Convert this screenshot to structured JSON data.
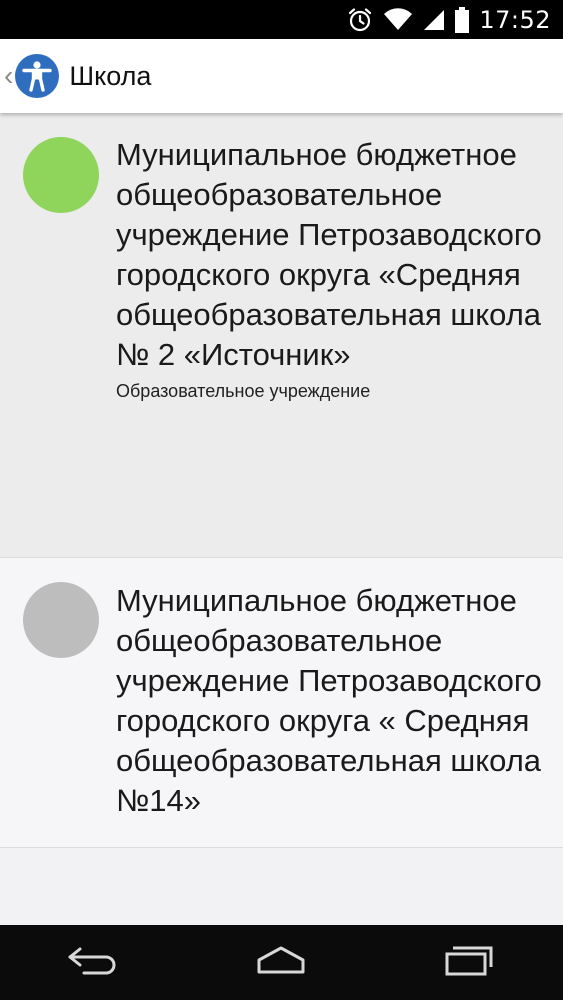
{
  "status_bar": {
    "time": "17:52",
    "icons": [
      "alarm-icon",
      "wifi-icon",
      "signal-icon",
      "battery-icon"
    ]
  },
  "action_bar": {
    "back_icon": "chevron-left-icon",
    "app_icon": "accessibility-icon",
    "title": "Школа",
    "app_icon_color": "#2f6ebf"
  },
  "list": {
    "items": [
      {
        "title": "Муниципальное бюджетное общеобразовательное учреждение Петрозаводского городского округа «Средняя общеобразовательная школа № 2 «Источник»",
        "subtitle": "Образовательное учреждение",
        "status_color": "#8fd45b"
      },
      {
        "title": "Муниципальное бюджетное общеобразовательное учреждение Петрозаводского городского округа « Средняя общеобразовательная школа №14»",
        "subtitle": "",
        "status_color": "#bdbdbd"
      }
    ]
  },
  "nav_bar": {
    "buttons": [
      "back-icon",
      "home-icon",
      "recent-apps-icon"
    ]
  }
}
